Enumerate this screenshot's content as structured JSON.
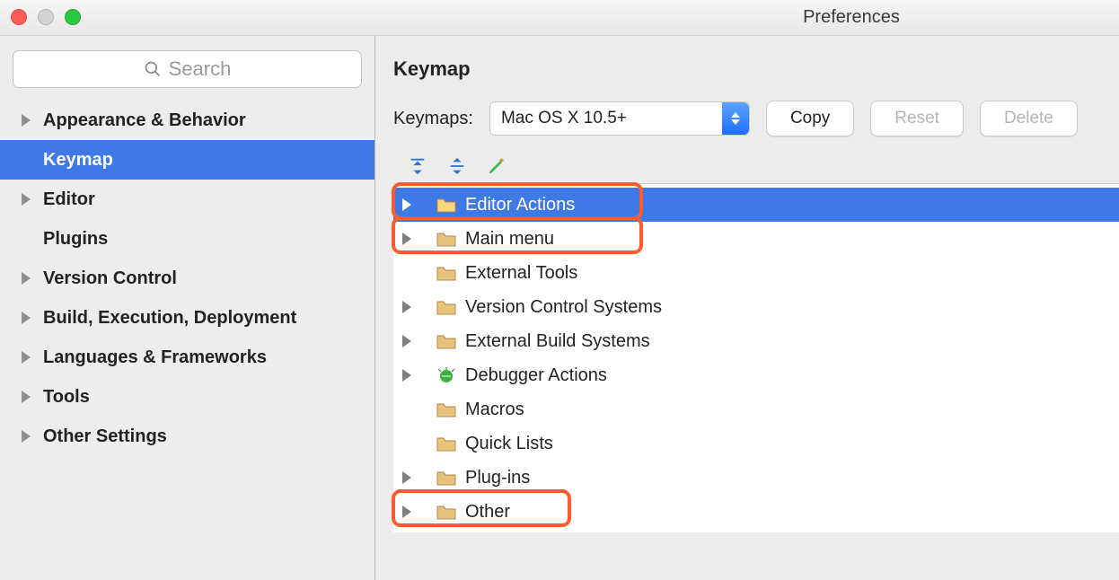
{
  "window": {
    "title": "Preferences"
  },
  "search": {
    "placeholder": "Search"
  },
  "sidebar": {
    "items": [
      {
        "label": "Appearance & Behavior",
        "expandable": true
      },
      {
        "label": "Keymap",
        "expandable": false,
        "selected": true
      },
      {
        "label": "Editor",
        "expandable": true
      },
      {
        "label": "Plugins",
        "expandable": false
      },
      {
        "label": "Version Control",
        "expandable": true
      },
      {
        "label": "Build, Execution, Deployment",
        "expandable": true
      },
      {
        "label": "Languages & Frameworks",
        "expandable": true
      },
      {
        "label": "Tools",
        "expandable": true
      },
      {
        "label": "Other Settings",
        "expandable": true
      }
    ]
  },
  "main": {
    "heading": "Keymap",
    "keymaps_label": "Keymaps:",
    "selected_keymap": "Mac OS X 10.5+",
    "buttons": {
      "copy": "Copy",
      "reset": "Reset",
      "delete": "Delete"
    }
  },
  "tree": [
    {
      "label": "Editor Actions",
      "expandable": true,
      "selected": true,
      "highlighted": true,
      "icon": "folder-edit"
    },
    {
      "label": "Main menu",
      "expandable": true,
      "selected": false,
      "highlighted": true,
      "icon": "folder-menu"
    },
    {
      "label": "External Tools",
      "expandable": false,
      "selected": false,
      "highlighted": false,
      "icon": "folder-wrench"
    },
    {
      "label": "Version Control Systems",
      "expandable": true,
      "selected": false,
      "highlighted": false,
      "icon": "folder"
    },
    {
      "label": "External Build Systems",
      "expandable": true,
      "selected": false,
      "highlighted": false,
      "icon": "folder-gear"
    },
    {
      "label": "Debugger Actions",
      "expandable": true,
      "selected": false,
      "highlighted": false,
      "icon": "bug"
    },
    {
      "label": "Macros",
      "expandable": false,
      "selected": false,
      "highlighted": false,
      "icon": "folder"
    },
    {
      "label": "Quick Lists",
      "expandable": false,
      "selected": false,
      "highlighted": false,
      "icon": "folder"
    },
    {
      "label": "Plug-ins",
      "expandable": true,
      "selected": false,
      "highlighted": false,
      "icon": "folder"
    },
    {
      "label": "Other",
      "expandable": true,
      "selected": false,
      "highlighted": true,
      "icon": "folder-dots"
    }
  ]
}
